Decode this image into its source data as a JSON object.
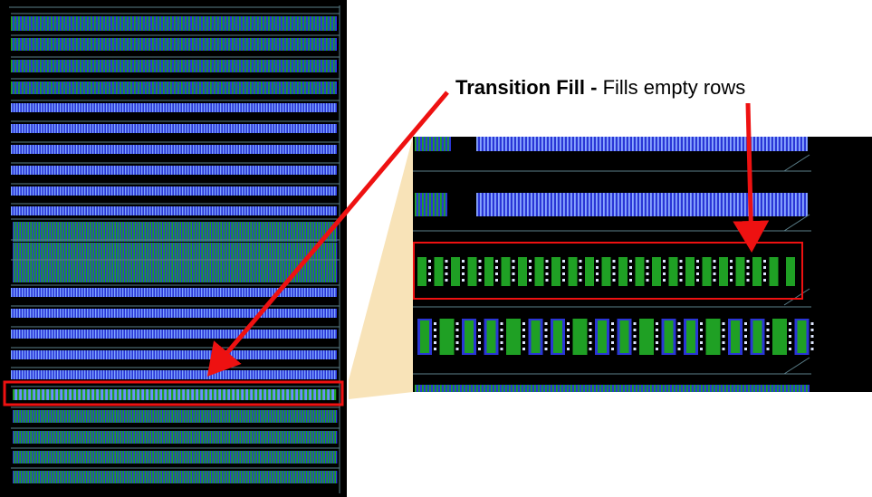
{
  "caption": {
    "title": "Transition Fill -",
    "description": "Fills empty rows"
  },
  "colors": {
    "background": "#000000",
    "cell_blue": "#2a36d6",
    "cell_green": "#1fa024",
    "rail": "#5b7f8a",
    "highlight": "#ee1111",
    "callout_fill": "#f8e3b8",
    "annotation_arrow": "#ee1111",
    "via_dot": "#dfe7ff"
  },
  "icons": {
    "arrow_to_layout": "red-arrow-icon",
    "arrow_to_zoom": "red-arrow-icon"
  },
  "legend": {
    "transition_fill_row": "highlighted",
    "zoom_region": "magnified"
  }
}
